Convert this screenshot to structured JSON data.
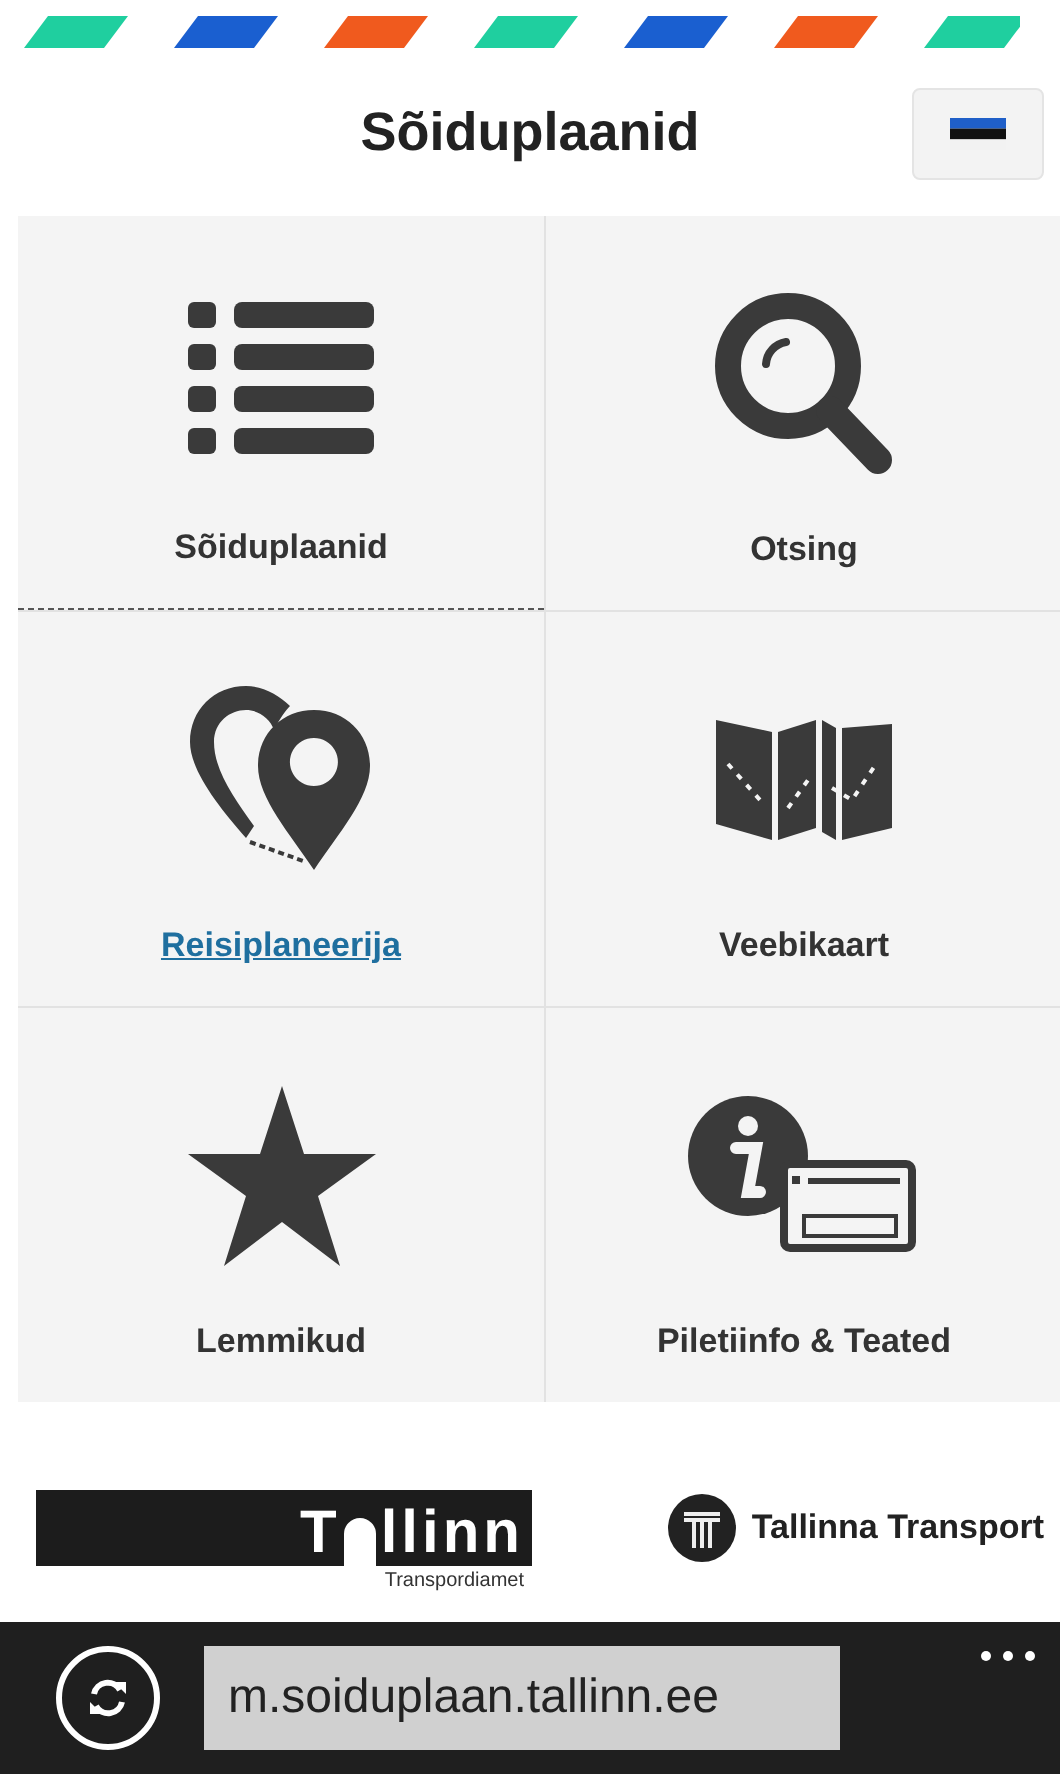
{
  "header": {
    "title": "Sõiduplaanid"
  },
  "tiles": [
    {
      "label": "Sõiduplaanid",
      "kind": "list",
      "selected": false
    },
    {
      "label": "Otsing",
      "kind": "search",
      "selected": false
    },
    {
      "label": "Reisiplaneerija",
      "kind": "pins",
      "selected": true
    },
    {
      "label": "Veebikaart",
      "kind": "map",
      "selected": false
    },
    {
      "label": "Lemmikud",
      "kind": "star",
      "selected": false
    },
    {
      "label": "Piletiinfo & Teated",
      "kind": "ticket",
      "selected": false
    }
  ],
  "footer": {
    "city_logo": {
      "left": "T",
      "right": "llinn",
      "caption": "Transpordiamet"
    },
    "operator": "Tallinna Transport"
  },
  "browser_bar": {
    "address": "m.soiduplaan.tallinn.ee"
  }
}
